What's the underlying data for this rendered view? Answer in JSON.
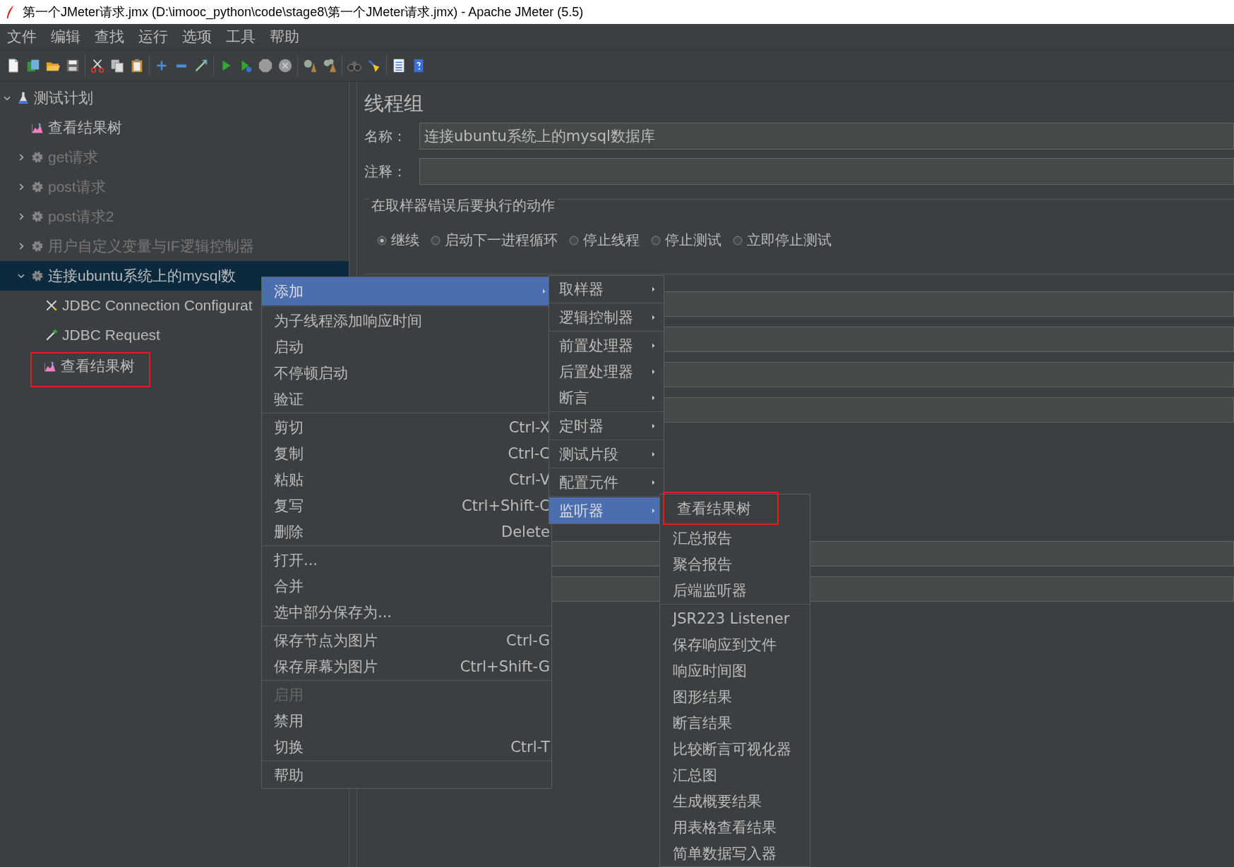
{
  "window": {
    "title": "第一个JMeter请求.jmx (D:\\imooc_python\\code\\stage8\\第一个JMeter请求.jmx) - Apache JMeter (5.5)"
  },
  "menu_bar": [
    "文件",
    "编辑",
    "查找",
    "运行",
    "选项",
    "工具",
    "帮助"
  ],
  "tree": [
    {
      "label": "测试计划",
      "kind": "plan",
      "expanded": true,
      "selected": false,
      "disabled": false,
      "annotated": false,
      "children": [
        {
          "label": "查看结果树",
          "kind": "listener",
          "selected": false,
          "disabled": false,
          "annotated": false
        },
        {
          "label": "get请求",
          "kind": "thread-group",
          "expanded": false,
          "selected": false,
          "disabled": true,
          "annotated": false
        },
        {
          "label": "post请求",
          "kind": "thread-group",
          "expanded": false,
          "selected": false,
          "disabled": true,
          "annotated": false
        },
        {
          "label": "post请求2",
          "kind": "thread-group",
          "expanded": false,
          "selected": false,
          "disabled": true,
          "annotated": false
        },
        {
          "label": "用户自定义变量与IF逻辑控制器",
          "kind": "thread-group",
          "expanded": false,
          "selected": false,
          "disabled": true,
          "annotated": false
        },
        {
          "label": "连接ubuntu系统上的mysql数",
          "kind": "thread-group",
          "expanded": true,
          "selected": true,
          "disabled": false,
          "annotated": false,
          "children": [
            {
              "label": "JDBC Connection Configurat",
              "kind": "config",
              "selected": false,
              "disabled": false,
              "annotated": false
            },
            {
              "label": "JDBC Request",
              "kind": "sampler",
              "selected": false,
              "disabled": false,
              "annotated": false
            },
            {
              "label": "查看结果树",
              "kind": "listener",
              "selected": false,
              "disabled": false,
              "annotated": true
            }
          ]
        }
      ]
    }
  ],
  "panel": {
    "title": "线程组",
    "name_label": "名称：",
    "name_value": "连接ubuntu系统上的mysql数据库",
    "comment_label": "注释：",
    "error_action": {
      "legend": "在取样器错误后要执行的动作",
      "options": [
        {
          "label": "继续",
          "selected": true
        },
        {
          "label": "启动下一进程循环",
          "selected": false
        },
        {
          "label": "停止线程",
          "selected": false
        },
        {
          "label": "停止测试",
          "selected": false
        },
        {
          "label": "立即停止测试",
          "selected": false
        }
      ]
    }
  },
  "context_menu": {
    "groups": [
      [
        {
          "label": "添加",
          "selected": true,
          "submenu": true,
          "disabled": false
        }
      ],
      [
        {
          "label": "为子线程添加响应时间",
          "selected": false,
          "submenu": false,
          "disabled": false
        },
        {
          "label": "启动",
          "selected": false,
          "submenu": false,
          "disabled": false
        },
        {
          "label": "不停顿启动",
          "selected": false,
          "submenu": false,
          "disabled": false
        },
        {
          "label": "验证",
          "selected": false,
          "submenu": false,
          "disabled": false
        }
      ],
      [
        {
          "label": "剪切",
          "shortcut": "Ctrl-X",
          "selected": false,
          "submenu": false,
          "disabled": false
        },
        {
          "label": "复制",
          "shortcut": "Ctrl-C",
          "selected": false,
          "submenu": false,
          "disabled": false
        },
        {
          "label": "粘贴",
          "shortcut": "Ctrl-V",
          "selected": false,
          "submenu": false,
          "disabled": false
        },
        {
          "label": "复写",
          "shortcut": "Ctrl+Shift-C",
          "selected": false,
          "submenu": false,
          "disabled": false
        },
        {
          "label": "删除",
          "shortcut": "Delete",
          "selected": false,
          "submenu": false,
          "disabled": false
        }
      ],
      [
        {
          "label": "打开...",
          "selected": false,
          "submenu": false,
          "disabled": false
        },
        {
          "label": "合并",
          "selected": false,
          "submenu": false,
          "disabled": false
        },
        {
          "label": "选中部分保存为...",
          "selected": false,
          "submenu": false,
          "disabled": false
        }
      ],
      [
        {
          "label": "保存节点为图片",
          "shortcut": "Ctrl-G",
          "selected": false,
          "submenu": false,
          "disabled": false
        },
        {
          "label": "保存屏幕为图片",
          "shortcut": "Ctrl+Shift-G",
          "selected": false,
          "submenu": false,
          "disabled": false
        }
      ],
      [
        {
          "label": "启用",
          "selected": false,
          "submenu": false,
          "disabled": true
        },
        {
          "label": "禁用",
          "selected": false,
          "submenu": false,
          "disabled": false
        },
        {
          "label": "切换",
          "shortcut": "Ctrl-T",
          "selected": false,
          "submenu": false,
          "disabled": false
        }
      ],
      [
        {
          "label": "帮助",
          "selected": false,
          "submenu": false,
          "disabled": false
        }
      ]
    ]
  },
  "add_submenu": {
    "groups": [
      [
        {
          "label": "取样器",
          "selected": false,
          "submenu": true
        }
      ],
      [
        {
          "label": "逻辑控制器",
          "selected": false,
          "submenu": true
        }
      ],
      [
        {
          "label": "前置处理器",
          "selected": false,
          "submenu": true
        },
        {
          "label": "后置处理器",
          "selected": false,
          "submenu": true
        },
        {
          "label": "断言",
          "selected": false,
          "submenu": true
        }
      ],
      [
        {
          "label": "定时器",
          "selected": false,
          "submenu": true
        }
      ],
      [
        {
          "label": "测试片段",
          "selected": false,
          "submenu": true
        }
      ],
      [
        {
          "label": "配置元件",
          "selected": false,
          "submenu": true
        }
      ],
      [
        {
          "label": "监听器",
          "selected": true,
          "submenu": true
        }
      ]
    ]
  },
  "listener_submenu": {
    "groups": [
      [
        {
          "label": "查看结果树",
          "annotated": true
        },
        {
          "label": "汇总报告",
          "annotated": false
        },
        {
          "label": "聚合报告",
          "annotated": false
        },
        {
          "label": "后端监听器",
          "annotated": false
        }
      ],
      [
        {
          "label": "JSR223 Listener",
          "annotated": false
        },
        {
          "label": "保存响应到文件",
          "annotated": false
        },
        {
          "label": "响应时间图",
          "annotated": false
        },
        {
          "label": "图形结果",
          "annotated": false
        },
        {
          "label": "断言结果",
          "annotated": false
        },
        {
          "label": "比较断言可视化器",
          "annotated": false
        },
        {
          "label": "汇总图",
          "annotated": false
        },
        {
          "label": "生成概要结果",
          "annotated": false
        },
        {
          "label": "用表格查看结果",
          "annotated": false
        },
        {
          "label": "简单数据写入器",
          "annotated": false
        }
      ]
    ]
  }
}
